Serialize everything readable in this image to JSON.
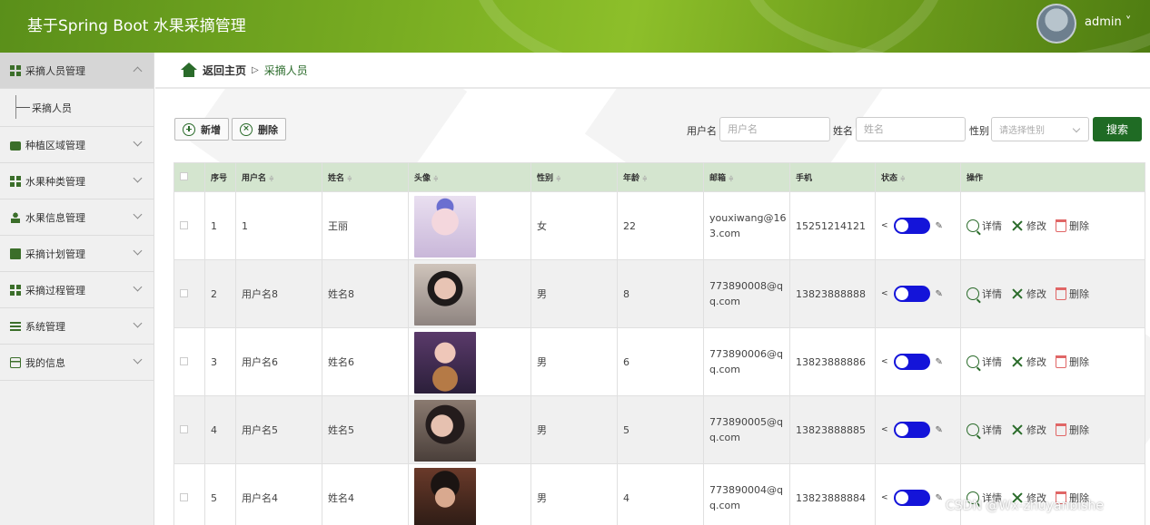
{
  "header": {
    "app_title": "基于Spring Boot 水果采摘管理",
    "user_name": "admin ˅"
  },
  "sidebar": {
    "groups": [
      {
        "label": "采摘人员管理",
        "icon": "grid-icon",
        "expanded": true,
        "children": [
          {
            "label": "采摘人员"
          }
        ]
      },
      {
        "label": "种植区域管理",
        "icon": "briefcase-icon"
      },
      {
        "label": "水果种类管理",
        "icon": "grid-icon"
      },
      {
        "label": "水果信息管理",
        "icon": "user-icon"
      },
      {
        "label": "采摘计划管理",
        "icon": "clipboard-icon"
      },
      {
        "label": "采摘过程管理",
        "icon": "grid-icon"
      },
      {
        "label": "系统管理",
        "icon": "bars-icon"
      },
      {
        "label": "我的信息",
        "icon": "card-icon"
      }
    ]
  },
  "breadcrumb": {
    "home": "返回主页",
    "separator": "▷",
    "current": "采摘人员"
  },
  "toolbar": {
    "add_label": "新增",
    "delete_label": "删除"
  },
  "search": {
    "username_label": "用户名",
    "username_placeholder": "用户名",
    "name_label": "姓名",
    "name_placeholder": "姓名",
    "gender_label": "性别",
    "gender_placeholder": "请选择性别",
    "search_label": "搜索"
  },
  "table": {
    "headers": [
      "",
      "序号",
      "用户名",
      "姓名",
      "头像",
      "性别",
      "年龄",
      "邮箱",
      "手机",
      "状态",
      "操作"
    ],
    "rows": [
      {
        "index": "1",
        "username": "1",
        "name": "王丽",
        "gender": "女",
        "age": "22",
        "email_line1": "youxiwang@16",
        "email_line2": "3.com",
        "phone": "15251214121"
      },
      {
        "index": "2",
        "username": "用户名8",
        "name": "姓名8",
        "gender": "男",
        "age": "8",
        "email_line1": "773890008@q",
        "email_line2": "q.com",
        "phone": "13823888888"
      },
      {
        "index": "3",
        "username": "用户名6",
        "name": "姓名6",
        "gender": "男",
        "age": "6",
        "email_line1": "773890006@q",
        "email_line2": "q.com",
        "phone": "13823888886"
      },
      {
        "index": "4",
        "username": "用户名5",
        "name": "姓名5",
        "gender": "男",
        "age": "5",
        "email_line1": "773890005@q",
        "email_line2": "q.com",
        "phone": "13823888885"
      },
      {
        "index": "5",
        "username": "用户名4",
        "name": "姓名4",
        "gender": "男",
        "age": "4",
        "email_line1": "773890004@q",
        "email_line2": "q.com",
        "phone": "13823888884"
      }
    ],
    "ops": {
      "detail": "详情",
      "edit": "修改",
      "delete": "删除"
    },
    "sort_glyph": "≑",
    "share_glyph": "<",
    "pencil_glyph": "✎"
  },
  "colors": {
    "accent": "#1f6b24",
    "header_green": "#79ad22",
    "toggle_blue": "#1414d9",
    "table_header": "#d4e5cf"
  },
  "watermark": "CSDN @Wx-zhuyanbishe"
}
